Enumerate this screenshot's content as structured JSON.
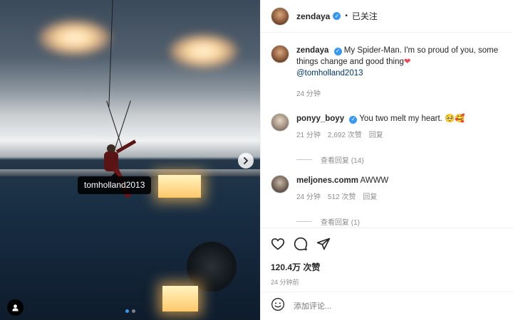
{
  "photo": {
    "tag_label": "tomholland2013",
    "carousel_count": 2,
    "carousel_active": 1
  },
  "header": {
    "username": "zendaya",
    "separator": "•",
    "follow_status": "已关注"
  },
  "caption": {
    "username": "zendaya",
    "text": "My Spider-Man. I'm so proud of you, some things change and good thing",
    "mention": "@tomholland2013",
    "time": "24 分钟"
  },
  "comments": [
    {
      "username": "ponyy_boyy",
      "verified": true,
      "text": "You two melt my heart. 🥺🥰",
      "time": "21 分钟",
      "likes": "2,692 次赞",
      "reply": "回复",
      "view_replies": "查看回复 (14)"
    },
    {
      "username": "meljones.comm",
      "verified": false,
      "text": "AWWW",
      "time": "24 分钟",
      "likes": "512 次赞",
      "reply": "回复",
      "view_replies": "查看回复 (1)"
    }
  ],
  "actions": {
    "like_count": "120.4万 次赞",
    "post_time": "24 分钟前"
  },
  "add_comment": {
    "placeholder": "添加评论..."
  },
  "colors": {
    "verified": "#3897f0",
    "heart": "#ed4956",
    "muted": "#8e8e8e"
  }
}
